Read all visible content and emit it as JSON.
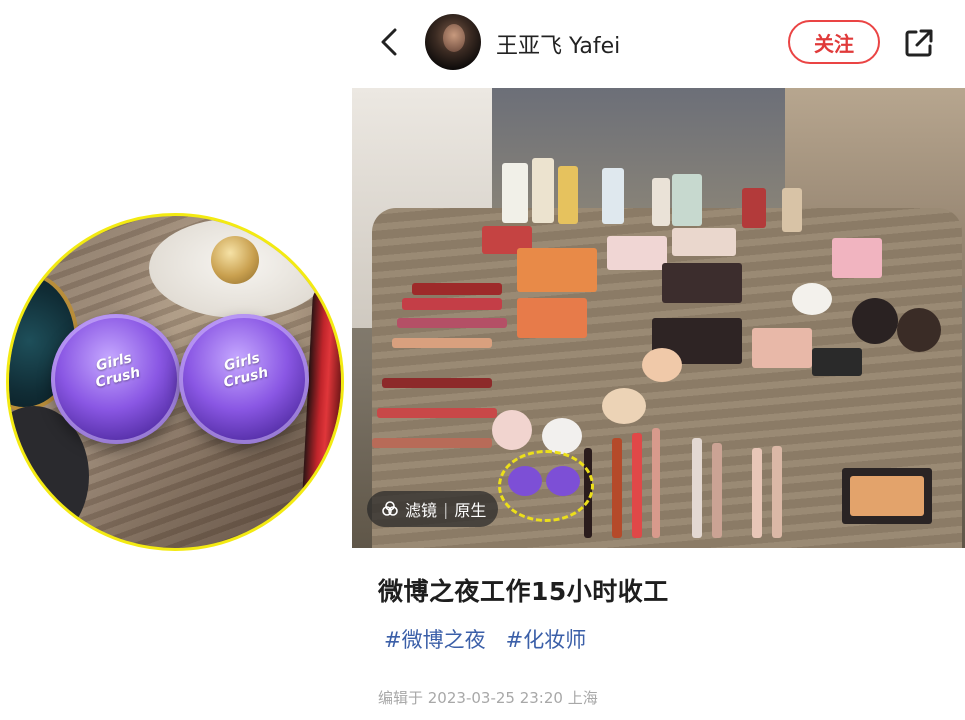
{
  "user": {
    "name": "王亚飞 Yafei"
  },
  "header": {
    "follow_label": "关注"
  },
  "photo": {
    "filter_label": "滤镜",
    "filter_value": "原生",
    "jar_label": "Girls Crush"
  },
  "post": {
    "title": "微博之夜工作15小时收工",
    "tags": [
      "#微博之夜",
      "#化妆师"
    ],
    "edited": "编辑于 2023-03-25 23:20 上海"
  },
  "colors": {
    "accent_red": "#e03a3a",
    "tag_blue": "#3b5fa8",
    "highlight_yellow": "#f3ea12"
  },
  "icons": [
    "back-icon",
    "share-icon",
    "filter-icon"
  ]
}
